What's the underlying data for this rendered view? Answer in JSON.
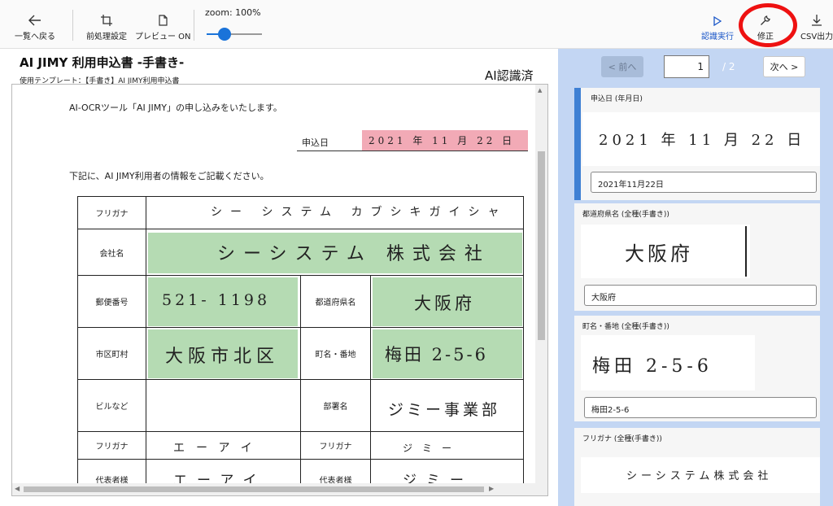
{
  "toolbar": {
    "back": "一覧へ戻る",
    "preprocess": "前処理設定",
    "preview": "プレビュー ON",
    "zoom_label": "zoom:",
    "zoom_value": "100%",
    "run": "認識実行",
    "fix": "修正",
    "csv": "CSV出力"
  },
  "document": {
    "title": "AI JIMY 利用申込書 -手書き-",
    "template": "使用テンプレート：【手書き】AI JIMY利用申込書",
    "status": "AI認識済",
    "intro": "AI-OCRツール「AI JIMY」の申し込みをいたします。",
    "date_label": "申込日",
    "date_hw": "2021 年 11 月 22 日",
    "instruction": "下記に、AI JIMY利用者の情報をご記載ください。",
    "form": {
      "furigana_label": "フリガナ",
      "furigana_hw": "シー システム カブシキガイシャ",
      "company_label": "会社名",
      "company_hw": "シーシステム 株式会社",
      "postal_label": "郵便番号",
      "postal_hw": "521- 1198",
      "prefecture_label": "都道府県名",
      "prefecture_hw": "大阪府",
      "city_label": "市区町村",
      "city_hw": "大阪市北区",
      "street_label": "町名・番地",
      "street_hw": "梅田 2-5-6",
      "building_label": "ビルなど",
      "dept_label": "部署名",
      "dept_hw": "ジミー事業部",
      "furigana2_label": "フリガナ",
      "furigana2_hw": "エーアイ",
      "furigana3_label": "フリガナ",
      "furigana3_hw": "ジミー",
      "rep_label": "代表者様",
      "rep_hw": "エーアイ",
      "rep2_label": "代表者様",
      "rep2_hw": "ジミー"
    }
  },
  "pager": {
    "prev": "< 前へ",
    "next": "次へ >",
    "current": "1",
    "total": "/ 2"
  },
  "fields": [
    {
      "label": "申込日 (年月日)",
      "image_text": "2021 年 11 月 22 日",
      "value": "2021年11月22日"
    },
    {
      "label": "都道府県名 (全種(手書き))",
      "image_text": "大阪府",
      "value": "大阪府"
    },
    {
      "label": "町名・番地 (全種(手書き))",
      "image_text": "梅田 2-5-6",
      "value": "梅田2-5-6"
    },
    {
      "label": "フリガナ (全種(手書き))",
      "image_text": "シーシステム株式会社",
      "value": ""
    }
  ],
  "colors": {
    "accent": "#1a73d9",
    "panel": "#c3d6f3",
    "active_card": "#3e80d4",
    "highlight_green": "#b5dbb3",
    "highlight_pink": "#f2aab6",
    "annotation_ring": "#ee1111"
  },
  "icons": {
    "back": "arrow-left-icon",
    "preprocess": "crop-icon",
    "preview": "document-icon",
    "run": "play-icon",
    "fix": "wrench-icon",
    "csv": "download-icon"
  }
}
